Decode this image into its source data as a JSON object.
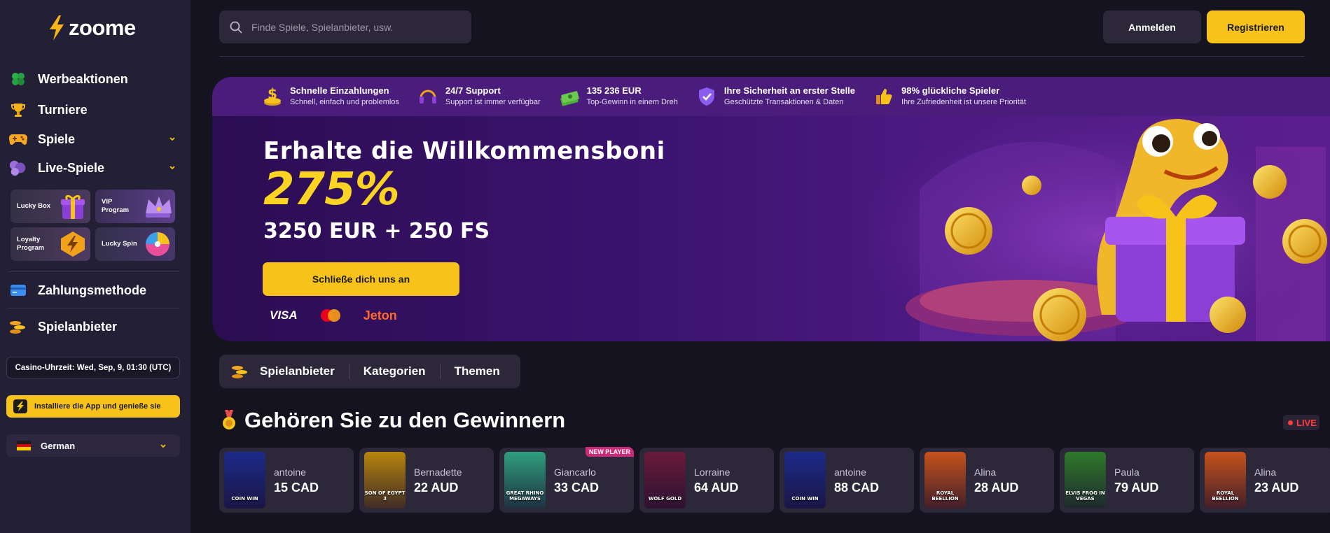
{
  "brand": {
    "name": "zoome"
  },
  "sidebar": {
    "nav": [
      {
        "label": "Werbeaktionen",
        "icon": "clover-icon"
      },
      {
        "label": "Turniere",
        "icon": "trophy-icon"
      },
      {
        "label": "Spiele",
        "icon": "gamepad-icon"
      },
      {
        "label": "Live-Spiele",
        "icon": "cards-icon"
      }
    ],
    "promos": [
      {
        "label": "Lucky Box"
      },
      {
        "label": "VIP Program"
      },
      {
        "label": "Loyalty Program"
      },
      {
        "label": "Lucky Spin"
      }
    ],
    "payments_label": "Zahlungsmethode",
    "providers_label": "Spielanbieter",
    "clock": "Casino-Uhrzeit: Wed, Sep, 9, 01:30 (UTC)",
    "install": "Installiere die App und genieße sie",
    "language": "German"
  },
  "header": {
    "search_placeholder": "Finde Spiele, Spielanbieter, usw.",
    "login": "Anmelden",
    "register": "Registrieren"
  },
  "features": [
    {
      "title": "Schnelle Einzahlungen",
      "subtitle": "Schnell, einfach und problemlos"
    },
    {
      "title": "24/7 Support",
      "subtitle": "Support ist immer verfügbar"
    },
    {
      "title": "135 236 EUR",
      "subtitle": "Top-Gewinn in einem Dreh"
    },
    {
      "title": "Ihre Sicherheit an erster Stelle",
      "subtitle": "Geschützte Transaktionen & Daten"
    },
    {
      "title": "98% glückliche Spieler",
      "subtitle": "Ihre Zufriedenheit ist unsere Priorität"
    }
  ],
  "hero": {
    "title": "Erhalte die Willkommensboni",
    "percent": "275%",
    "amount": "3250 EUR + 250 FS",
    "cta": "Schließe dich uns an",
    "payments": {
      "visa": "VISA",
      "jeton": "Jeton"
    }
  },
  "tabs": [
    "Spielanbieter",
    "Kategorien",
    "Themen"
  ],
  "winners": {
    "title": "Gehören Sie zu den Gewinnern",
    "live": "LIVE",
    "items": [
      {
        "name": "antoine",
        "amount": "15 CAD",
        "game": "COIN WIN",
        "color": "#1c2a8a"
      },
      {
        "name": "Bernadette",
        "amount": "22 AUD",
        "game": "SON OF EGYPT 3",
        "color": "#b8860b"
      },
      {
        "name": "Giancarlo",
        "amount": "33 CAD",
        "game": "GREAT RHINO MEGAWAYS",
        "color": "#2f9f7d",
        "badge": "NEW PLAYER"
      },
      {
        "name": "Lorraine",
        "amount": "64 AUD",
        "game": "WOLF GOLD",
        "color": "#6a1a3a"
      },
      {
        "name": "antoine",
        "amount": "88 CAD",
        "game": "COIN WIN",
        "color": "#1c2a8a"
      },
      {
        "name": "Alina",
        "amount": "28 AUD",
        "game": "ROYAL BEELLION",
        "color": "#c7521a"
      },
      {
        "name": "Paula",
        "amount": "79 AUD",
        "game": "ELVIS FROG IN VEGAS",
        "color": "#2e7a2a"
      },
      {
        "name": "Alina",
        "amount": "23 AUD",
        "game": "ROYAL BEELLION",
        "color": "#c7521a"
      }
    ]
  },
  "colors": {
    "accent": "#f7c21a",
    "sidebar": "#231f35",
    "background": "#151320",
    "live": "#ff3b3b"
  }
}
